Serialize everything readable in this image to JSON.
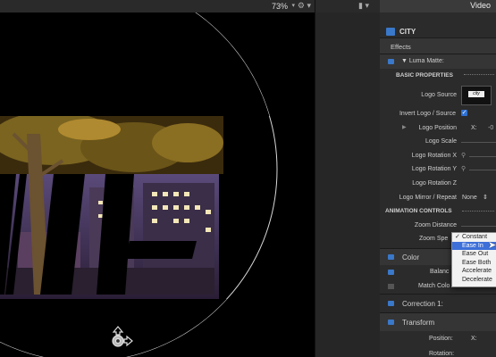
{
  "viewer": {
    "zoom": "73%",
    "zoom_caret": "▾",
    "gear": "⚙ ▾",
    "city_text": "...HTS'"
  },
  "gutter": {
    "icons": "▮ ▾"
  },
  "inspector": {
    "tab": "Video",
    "clip_name": "CITY",
    "effects_header": "Effects",
    "effect_name": "▼ Luma Matte:",
    "basic_properties": "BASIC PROPERTIES",
    "rows": {
      "logo_source": "Logo Source",
      "logo_source_thumb_text": "city",
      "invert": "Invert Logo / Source",
      "logo_position": "Logo Position",
      "logo_position_x": "X:",
      "logo_position_x_value": "-0",
      "logo_scale": "Logo Scale",
      "logo_rotation_x": "Logo Rotation X",
      "logo_rotation_y": "Logo Rotation Y",
      "logo_rotation_z": "Logo Rotation Z",
      "logo_mirror": "Logo Mirror / Repeat",
      "logo_mirror_value": "None",
      "logo_mirror_caret": "⇕",
      "animation_controls": "ANIMATION CONTROLS",
      "zoom_distance": "Zoom Distance",
      "zoom_speed": "Zoom Spe"
    },
    "color_section": "Color",
    "balance": "Balanc",
    "match_color": "Match Colo",
    "correction": "Correction 1:",
    "transform": "Transform",
    "position": "Position:",
    "position_x": "X:",
    "rotation": "Rotation:"
  },
  "dropdown": {
    "items": [
      "Constant",
      "Ease In",
      "Ease Out",
      "Ease Both",
      "Accelerate",
      "Decelerate"
    ],
    "checked": "Constant",
    "highlighted": "Ease In",
    "check_glyph": "✓"
  },
  "colors": {
    "accent": "#3a78c9",
    "highlight": "#3c6fd8"
  }
}
